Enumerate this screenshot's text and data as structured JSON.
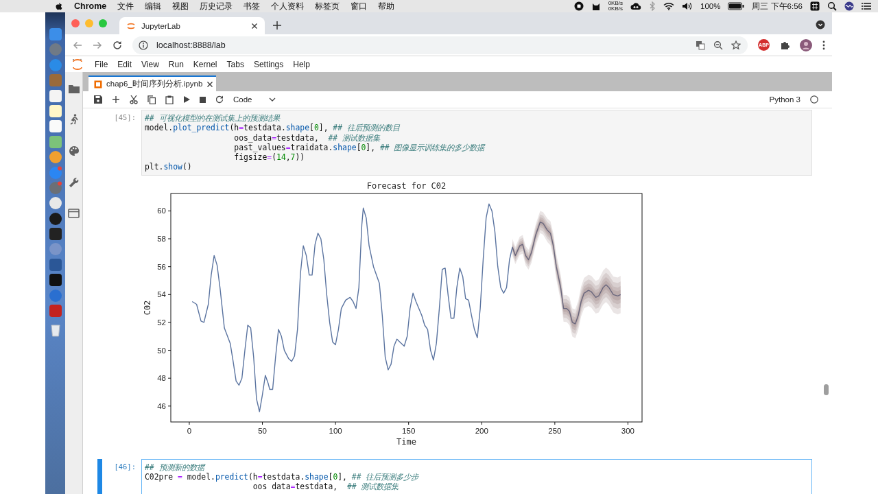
{
  "menubar": {
    "app": "Chrome",
    "menus": [
      "文件",
      "编辑",
      "视图",
      "历史记录",
      "书签",
      "个人资料",
      "标签页",
      "窗口",
      "帮助"
    ],
    "net_up": "0KB/s",
    "net_down": "0KB/s",
    "battery": "100%",
    "clock": "周三 下午6:56"
  },
  "browser": {
    "tab_title": "JupyterLab",
    "url": "localhost:8888/lab",
    "extension_badge": "ABP"
  },
  "jupyter": {
    "menus": [
      "File",
      "Edit",
      "View",
      "Run",
      "Kernel",
      "Tabs",
      "Settings",
      "Help"
    ],
    "doc_tab": "chap6_时间序列分析.ipynb",
    "toolbar": {
      "cell_type": "Code",
      "kernel": "Python 3"
    },
    "cells": [
      {
        "prompt": "[45]:",
        "selected": false,
        "lines": [
          [
            {
              "kind": "comment",
              "text": "## 可视化模型的在测试集上的预测结果"
            }
          ],
          [
            {
              "kind": "plain",
              "text": "model."
            },
            {
              "kind": "attr",
              "text": "plot_predict"
            },
            {
              "kind": "plain",
              "text": "(h"
            },
            {
              "kind": "op",
              "text": "="
            },
            {
              "kind": "plain",
              "text": "testdata."
            },
            {
              "kind": "attr",
              "text": "shape"
            },
            {
              "kind": "plain",
              "text": "["
            },
            {
              "kind": "num",
              "text": "0"
            },
            {
              "kind": "plain",
              "text": "], "
            },
            {
              "kind": "comment",
              "text": "## 往后预测的数目"
            }
          ],
          [
            {
              "kind": "plain",
              "text": "                   oos_data"
            },
            {
              "kind": "op",
              "text": "="
            },
            {
              "kind": "plain",
              "text": "testdata,  "
            },
            {
              "kind": "comment",
              "text": "## 测试数据集"
            }
          ],
          [
            {
              "kind": "plain",
              "text": "                   past_values"
            },
            {
              "kind": "op",
              "text": "="
            },
            {
              "kind": "plain",
              "text": "traidata."
            },
            {
              "kind": "attr",
              "text": "shape"
            },
            {
              "kind": "plain",
              "text": "["
            },
            {
              "kind": "num",
              "text": "0"
            },
            {
              "kind": "plain",
              "text": "], "
            },
            {
              "kind": "comment",
              "text": "## 图像显示训练集的多少数据"
            }
          ],
          [
            {
              "kind": "plain",
              "text": "                   figsize"
            },
            {
              "kind": "op",
              "text": "="
            },
            {
              "kind": "plain",
              "text": "("
            },
            {
              "kind": "num",
              "text": "14"
            },
            {
              "kind": "plain",
              "text": ","
            },
            {
              "kind": "num",
              "text": "7"
            },
            {
              "kind": "plain",
              "text": "))"
            }
          ],
          [
            {
              "kind": "plain",
              "text": "plt."
            },
            {
              "kind": "attr",
              "text": "show"
            },
            {
              "kind": "plain",
              "text": "()"
            }
          ]
        ],
        "output": {
          "chart_data": {
            "type": "line",
            "title": "Forecast for C02",
            "xlabel": "Time",
            "ylabel": "C02",
            "x": [
              2,
              5,
              8,
              10,
              13,
              15,
              17,
              19,
              21,
              24,
              28,
              30,
              32,
              34,
              36,
              38,
              40,
              42,
              44,
              46,
              48,
              50,
              52,
              54,
              55,
              57,
              59,
              61,
              63,
              65,
              68,
              70,
              72,
              74,
              76,
              78,
              80,
              82,
              84,
              86,
              88,
              90,
              92,
              94,
              96,
              98,
              100,
              102,
              104,
              107,
              110,
              112,
              114,
              116,
              118,
              119,
              121,
              123,
              126,
              130,
              132,
              134,
              136,
              138,
              140,
              142,
              144,
              147,
              149,
              151,
              153,
              155,
              157,
              159,
              161,
              163,
              165,
              167,
              169,
              171,
              173,
              175,
              177,
              179,
              181,
              183,
              185,
              187,
              189,
              191,
              193,
              195,
              197,
              199,
              201,
              203,
              205,
              207,
              209,
              211,
              213,
              215,
              217,
              219,
              221,
              223,
              226,
              228,
              230,
              232,
              234,
              237,
              240,
              242,
              245,
              247,
              249,
              251,
              254,
              256,
              258,
              260,
              262,
              264,
              266,
              268,
              270,
              273,
              275,
              278,
              280,
              283,
              285,
              287,
              290,
              293,
              295
            ],
            "series": [
              {
                "color": "#5b74a0",
                "values": [
                  53.5,
                  53.3,
                  52.1,
                  52.0,
                  53.3,
                  55.4,
                  56.8,
                  56.1,
                  54.5,
                  51.6,
                  50.5,
                  49.2,
                  47.8,
                  47.5,
                  48.0,
                  50.0,
                  51.8,
                  51.6,
                  49.5,
                  46.5,
                  45.6,
                  46.8,
                  48.2,
                  47.6,
                  47.2,
                  47.2,
                  49.5,
                  51.5,
                  51.0,
                  50.0,
                  49.4,
                  49.2,
                  49.6,
                  51.5,
                  55.5,
                  57.5,
                  56.8,
                  55.4,
                  55.4,
                  57.6,
                  58.4,
                  58.0,
                  56.5,
                  54.0,
                  52.0,
                  50.6,
                  50.4,
                  51.5,
                  53.0,
                  53.6,
                  53.8,
                  53.5,
                  53.0,
                  54.5,
                  59.0,
                  60.2,
                  59.5,
                  57.5,
                  56.0,
                  54.8,
                  52.5,
                  49.5,
                  48.6,
                  49.0,
                  50.3,
                  50.8,
                  50.6,
                  50.3,
                  51.0,
                  53.0,
                  54.1,
                  53.5,
                  53.0,
                  52.5,
                  51.8,
                  51.5,
                  50.0,
                  49.3,
                  50.5,
                  53.0,
                  55.8,
                  55.9,
                  54.0,
                  52.3,
                  52.3,
                  54.5,
                  55.9,
                  55.3,
                  53.7,
                  53.6,
                  52.5,
                  51.5,
                  50.9,
                  53.0,
                  56.5,
                  59.5,
                  60.5,
                  60.0,
                  58.5,
                  56.0,
                  54.5,
                  54.1,
                  54.5,
                  56.5,
                  57.4,
                  56.8,
                  57.5,
                  57.6,
                  56.8,
                  56.5,
                  57.0,
                  58.3,
                  59.2,
                  59.1,
                  58.6,
                  58.4,
                  57.5,
                  56.0,
                  54.5,
                  53.0,
                  53.0,
                  52.8,
                  52.0,
                  51.9,
                  52.5,
                  53.5,
                  54.1,
                  54.3,
                  54.2,
                  53.8,
                  53.9,
                  54.5,
                  54.7,
                  54.5,
                  54.0,
                  53.9,
                  54.0
                ]
              }
            ],
            "xlim": [
              -12.65,
              309.65
            ],
            "ylim": [
              44.86,
              61.25
            ],
            "xticks": [
              0,
              50,
              100,
              150,
              200,
              250,
              300
            ],
            "yticks": [
              46,
              48,
              50,
              52,
              54,
              56,
              58,
              60
            ]
          }
        }
      },
      {
        "prompt": "[46]:",
        "selected": true,
        "lines": [
          [
            {
              "kind": "comment",
              "text": "## 预测新的数据"
            }
          ],
          [
            {
              "kind": "plain",
              "text": "C02pre "
            },
            {
              "kind": "op",
              "text": "="
            },
            {
              "kind": "plain",
              "text": " model."
            },
            {
              "kind": "attr",
              "text": "predict"
            },
            {
              "kind": "plain",
              "text": "(h"
            },
            {
              "kind": "op",
              "text": "="
            },
            {
              "kind": "plain",
              "text": "testdata."
            },
            {
              "kind": "attr",
              "text": "shape"
            },
            {
              "kind": "plain",
              "text": "["
            },
            {
              "kind": "num",
              "text": "0"
            },
            {
              "kind": "plain",
              "text": "], "
            },
            {
              "kind": "comment",
              "text": "## 往后预测多少步"
            }
          ],
          [
            {
              "kind": "plain",
              "text": "                       oos data"
            },
            {
              "kind": "op",
              "text": "="
            },
            {
              "kind": "plain",
              "text": "testdata,  "
            },
            {
              "kind": "comment",
              "text": "## 测试数据集"
            }
          ]
        ]
      }
    ]
  }
}
